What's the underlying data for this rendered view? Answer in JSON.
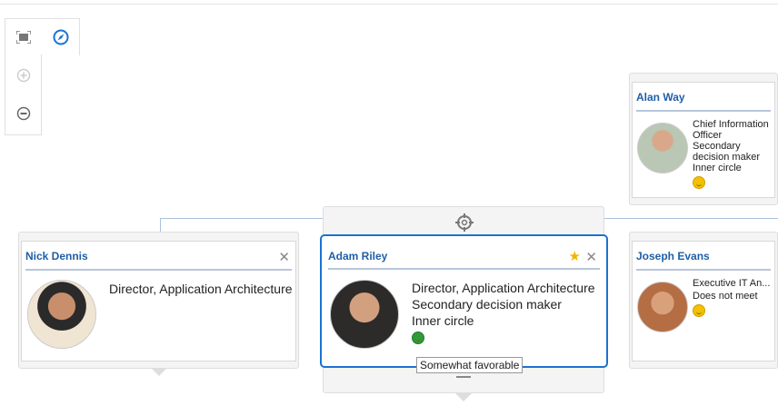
{
  "toolbar": {
    "items": [
      "fit-to-screen",
      "navigate",
      "zoom-in",
      "zoom-out"
    ]
  },
  "colors": {
    "accent": "#1f5fa6",
    "selected_border": "#1a73d1",
    "favorable": "#2e9b3a",
    "neutral": "#f2c100"
  },
  "cards": {
    "nick": {
      "name": "Nick Dennis",
      "title": "Director, Application Architecture"
    },
    "adam": {
      "name": "Adam Riley",
      "title": "Director, Application Architecture",
      "role": "Secondary decision maker",
      "circle": "Inner circle",
      "tooltip": "Somewhat favorable"
    },
    "alan": {
      "name": "Alan Way",
      "title": "Chief Information Officer",
      "role": "Secondary decision maker",
      "circle": "Inner circle"
    },
    "joseph": {
      "name": "Joseph Evans",
      "title": "Executive IT An...",
      "role": "Does not meet"
    }
  }
}
